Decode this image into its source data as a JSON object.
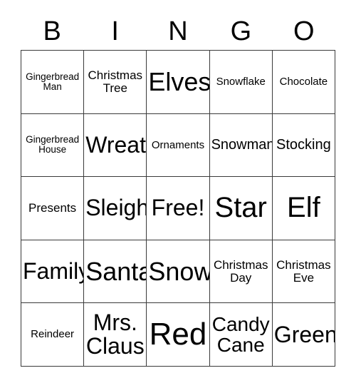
{
  "card": {
    "title": "BINGO",
    "header_letters": [
      "B",
      "I",
      "N",
      "G",
      "O"
    ],
    "columns": 5,
    "rows": 5,
    "free_space_label": "Free!",
    "free_space_position": "center",
    "colors": {
      "background": "#ffffff",
      "text": "#000000",
      "grid_line": "#3a3a3a"
    },
    "cells": [
      [
        {
          "label": "Gingerbread Man",
          "size": "xxs",
          "lines": 2
        },
        {
          "label": "Christmas Tree",
          "size": "sm",
          "lines": 2
        },
        {
          "label": "Elves",
          "size": "3xl",
          "lines": 1
        },
        {
          "label": "Snowflake",
          "size": "xs",
          "lines": 1
        },
        {
          "label": "Chocolate",
          "size": "xs",
          "lines": 1
        }
      ],
      [
        {
          "label": "Gingerbread House",
          "size": "xxs",
          "lines": 2
        },
        {
          "label": "Wreath",
          "size": "2xl",
          "lines": 1
        },
        {
          "label": "Ornaments",
          "size": "xs",
          "lines": 1
        },
        {
          "label": "Snowman",
          "size": "md",
          "lines": 1
        },
        {
          "label": "Stocking",
          "size": "md",
          "lines": 1
        }
      ],
      [
        {
          "label": "Presents",
          "size": "sm",
          "lines": 1
        },
        {
          "label": "Sleigh",
          "size": "2xl",
          "lines": 1
        },
        {
          "label": "Free!",
          "size": "2xl",
          "lines": 1
        },
        {
          "label": "Star",
          "size": "4xl",
          "lines": 1
        },
        {
          "label": "Elf",
          "size": "4xl",
          "lines": 1
        }
      ],
      [
        {
          "label": "Family",
          "size": "2xl",
          "lines": 1
        },
        {
          "label": "Santa",
          "size": "3xl",
          "lines": 1
        },
        {
          "label": "Snow",
          "size": "3xl",
          "lines": 1
        },
        {
          "label": "Christmas Day",
          "size": "sm",
          "lines": 2
        },
        {
          "label": "Christmas Eve",
          "size": "sm",
          "lines": 2
        }
      ],
      [
        {
          "label": "Reindeer",
          "size": "xs",
          "lines": 1
        },
        {
          "label": "Mrs. Claus",
          "size": "2xl",
          "lines": 2
        },
        {
          "label": "Red",
          "size": "5xl",
          "lines": 1
        },
        {
          "label": "Candy Cane",
          "size": "xl",
          "lines": 2
        },
        {
          "label": "Green",
          "size": "2xl",
          "lines": 1
        }
      ]
    ]
  }
}
